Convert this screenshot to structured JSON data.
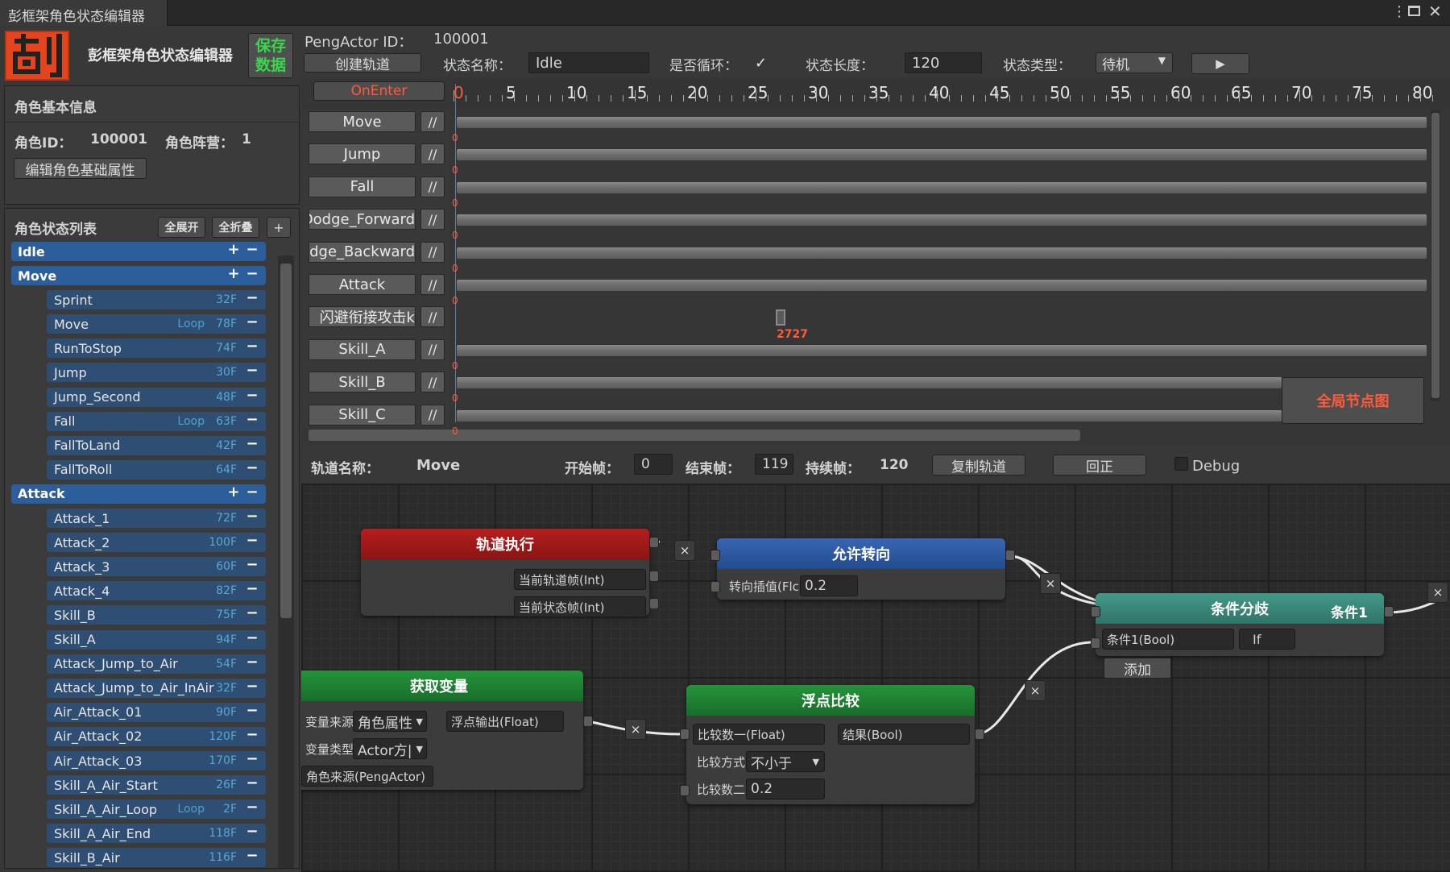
{
  "window": {
    "tab_title": "彭框架角色状态编辑器",
    "menu_icon": "more-vert-icon",
    "max_icon": "maximize-icon",
    "close_icon": "close-icon"
  },
  "header": {
    "app_title": "彭框架角色状态编辑器",
    "save_label": "保存\n数据",
    "peng_actor_id_label": "PengActor ID：",
    "peng_actor_id": "100001",
    "create_track": "创建轨道",
    "state_name_label": "状态名称：",
    "state_name": "Idle",
    "loop_label": "是否循环：",
    "loop_checked": true,
    "length_label": "状态长度：",
    "length_value": "120",
    "type_label": "状态类型：",
    "type_value": "待机",
    "play_icon": "play-icon"
  },
  "basic_info": {
    "title": "角色基本信息",
    "id_label": "角色ID：",
    "id_value": "100001",
    "camp_label": "角色阵营：",
    "camp_value": "1",
    "edit_button": "编辑角色基础属性"
  },
  "state_list": {
    "title": "角色状态列表",
    "expand_all": "全展开",
    "collapse_all": "全折叠",
    "add": "+",
    "groups": [
      {
        "name": "Idle"
      },
      {
        "name": "Move"
      },
      {
        "name": "Attack"
      }
    ],
    "move_items": [
      {
        "name": "Sprint",
        "loop": "",
        "frames": "32F"
      },
      {
        "name": "Move",
        "loop": "Loop",
        "frames": "78F"
      },
      {
        "name": "RunToStop",
        "loop": "",
        "frames": "74F"
      },
      {
        "name": "Jump",
        "loop": "",
        "frames": "30F"
      },
      {
        "name": "Jump_Second",
        "loop": "",
        "frames": "48F"
      },
      {
        "name": "Fall",
        "loop": "Loop",
        "frames": "63F"
      },
      {
        "name": "FallToLand",
        "loop": "",
        "frames": "42F"
      },
      {
        "name": "FallToRoll",
        "loop": "",
        "frames": "64F"
      }
    ],
    "attack_items": [
      {
        "name": "Attack_1",
        "loop": "",
        "frames": "72F"
      },
      {
        "name": "Attack_2",
        "loop": "",
        "frames": "100F"
      },
      {
        "name": "Attack_3",
        "loop": "",
        "frames": "60F"
      },
      {
        "name": "Attack_4",
        "loop": "",
        "frames": "82F"
      },
      {
        "name": "Skill_B",
        "loop": "",
        "frames": "75F"
      },
      {
        "name": "Skill_A",
        "loop": "",
        "frames": "94F"
      },
      {
        "name": "Attack_Jump_to_Air",
        "loop": "",
        "frames": "54F"
      },
      {
        "name": "Attack_Jump_to_Air_InAir",
        "loop": "",
        "frames": "32F"
      },
      {
        "name": "Air_Attack_01",
        "loop": "",
        "frames": "90F"
      },
      {
        "name": "Air_Attack_02",
        "loop": "",
        "frames": "120F"
      },
      {
        "name": "Air_Attack_03",
        "loop": "",
        "frames": "170F"
      },
      {
        "name": "Skill_A_Air_Start",
        "loop": "",
        "frames": "26F"
      },
      {
        "name": "Skill_A_Air_Loop",
        "loop": "Loop",
        "frames": "2F"
      },
      {
        "name": "Skill_A_Air_End",
        "loop": "",
        "frames": "118F"
      },
      {
        "name": "Skill_B_Air",
        "loop": "",
        "frames": "116F"
      }
    ]
  },
  "timeline": {
    "on_enter": "OnEnter",
    "ticks": [
      "0",
      "5",
      "10",
      "15",
      "20",
      "25",
      "30",
      "35",
      "40",
      "45",
      "50",
      "55",
      "60",
      "65",
      "70",
      "75",
      "80"
    ],
    "tracks": [
      {
        "name": "Move",
        "slash": "//",
        "zero": "0"
      },
      {
        "name": "Jump",
        "slash": "//",
        "zero": "0"
      },
      {
        "name": "Fall",
        "slash": "//",
        "zero": "0"
      },
      {
        "name": "Dodge_Forward",
        "slash": "//",
        "zero": "0"
      },
      {
        "name": "Dodge_Backward",
        "slash": "//",
        "zero": "0"
      },
      {
        "name": "Attack",
        "slash": "//",
        "zero": "0"
      },
      {
        "name": "闪避衔接攻击k",
        "slash": "//",
        "zero": ""
      },
      {
        "name": "Skill_A",
        "slash": "//",
        "zero": "0"
      },
      {
        "name": "Skill_B",
        "slash": "//",
        "zero": "0"
      },
      {
        "name": "Skill_C",
        "slash": "//",
        "zero": "0"
      }
    ],
    "marker_label": "2727",
    "global_node_button": "全局节点图"
  },
  "track_detail": {
    "name_label": "轨道名称：",
    "name_value": "Move",
    "start_label": "开始帧：",
    "start_value": "0",
    "end_label": "结束帧：",
    "end_value": "119",
    "duration_label": "持续帧：",
    "duration_value": "120",
    "copy_track": "复制轨道",
    "reset": "回正",
    "debug_label": "Debug"
  },
  "nodes": {
    "track_exec": {
      "title": "轨道执行",
      "out1": "当前轨道帧(Int)",
      "out2": "当前状态帧(Int)"
    },
    "allow_turn": {
      "title": "允许转向",
      "in1": "转向插值(Flc",
      "in1_value": "0.2"
    },
    "branch": {
      "title": "条件分歧",
      "out_label": "条件1",
      "cond1": "条件1(Bool)",
      "if_label": "If",
      "add_label": "添加"
    },
    "get_var": {
      "title": "获取变量",
      "source_label": "变量来源|",
      "source_value": "角色属性",
      "type_label": "变量类型|",
      "type_value": "Actor方|",
      "actor_label": "角色来源(PengActor)",
      "out": "浮点输出(Float)"
    },
    "float_cmp": {
      "title": "浮点比较",
      "in1": "比较数一(Float)",
      "result": "结果(Bool)",
      "mode_label": "比较方式|",
      "mode_value": "不小于",
      "in2": "比较数二|",
      "in2_value": "0.2"
    },
    "remove_symbol": "×"
  },
  "colors": {
    "red_node": "#a31a1a",
    "blue_node": "#2e5aa3",
    "teal_node": "#3b8a7d",
    "green_node": "#1e7a2a",
    "accent_orange": "#ff5a3c"
  }
}
